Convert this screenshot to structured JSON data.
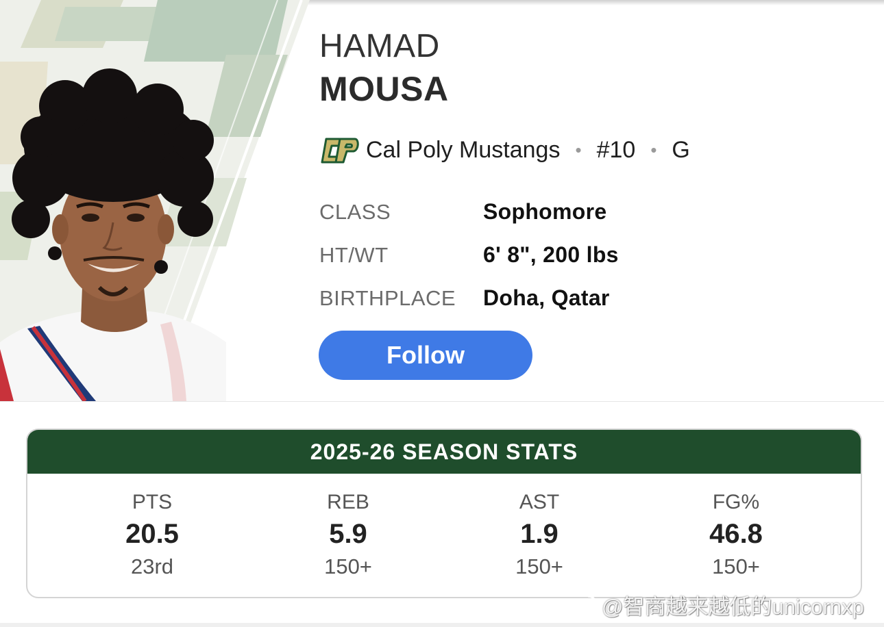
{
  "player": {
    "first_name": "HAMAD",
    "last_name": "MOUSA",
    "team": "Cal Poly Mustangs",
    "team_logo_text": "CP",
    "number": "#10",
    "position": "G",
    "separator": "•",
    "photo_icon": "player-headshot"
  },
  "info": [
    {
      "label": "CLASS",
      "value": "Sophomore"
    },
    {
      "label": "HT/WT",
      "value": "6' 8\", 200 lbs"
    },
    {
      "label": "BIRTHPLACE",
      "value": "Doha, Qatar"
    }
  ],
  "follow_label": "Follow",
  "stats": {
    "title": "2025-26 SEASON STATS",
    "items": [
      {
        "label": "PTS",
        "value": "20.5",
        "rank": "23rd"
      },
      {
        "label": "REB",
        "value": "5.9",
        "rank": "150+"
      },
      {
        "label": "AST",
        "value": "1.9",
        "rank": "150+"
      },
      {
        "label": "FG%",
        "value": "46.8",
        "rank": "150+"
      }
    ]
  },
  "watermark": "@智商越来越低的unicornxp",
  "colors": {
    "follow_button": "#3f7ae6",
    "stats_header": "#1f4d2c",
    "team_logo_green": "#1e5a32",
    "team_logo_gold": "#c9b86a"
  }
}
